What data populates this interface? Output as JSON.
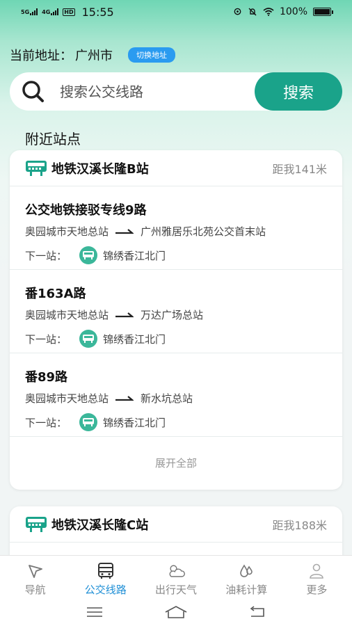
{
  "status_bar": {
    "signal1": "5G",
    "signal2": "4G",
    "hd": "HD",
    "time": "15:55",
    "battery": "100%"
  },
  "location": {
    "label": "当前地址：",
    "city": "广州市",
    "switch_label": "切换地址"
  },
  "search": {
    "placeholder": "搜索公交线路",
    "button_label": "搜索"
  },
  "section_title": "附近站点",
  "stations": [
    {
      "name": "地铁汉溪长隆B站",
      "distance": "距我141米",
      "routes": [
        {
          "name": "公交地铁接驳专线9路",
          "from": "奥园城市天地总站",
          "to": "广州雅居乐北苑公交首末站",
          "next_label": "下一站：",
          "next_stop": "锦绣香江北门"
        },
        {
          "name": "番163A路",
          "from": "奥园城市天地总站",
          "to": "万达广场总站",
          "next_label": "下一站：",
          "next_stop": "锦绣香江北门"
        },
        {
          "name": "番89路",
          "from": "奥园城市天地总站",
          "to": "新水坑总站",
          "next_label": "下一站：",
          "next_stop": "锦绣香江北门"
        }
      ],
      "expand_label": "展开全部"
    },
    {
      "name": "地铁汉溪长隆C站",
      "distance": "距我188米"
    }
  ],
  "tabs": [
    {
      "label": "导航",
      "icon": "navigation-arrow-icon"
    },
    {
      "label": "公交线路",
      "icon": "bus-icon",
      "active": true
    },
    {
      "label": "出行天气",
      "icon": "weather-icon"
    },
    {
      "label": "油耗计算",
      "icon": "fuel-drop-icon"
    },
    {
      "label": "更多",
      "icon": "person-icon"
    }
  ],
  "colors": {
    "accent": "#1aa38a",
    "switch_button": "#2a9bf0",
    "active_tab": "#1f8fd6"
  }
}
